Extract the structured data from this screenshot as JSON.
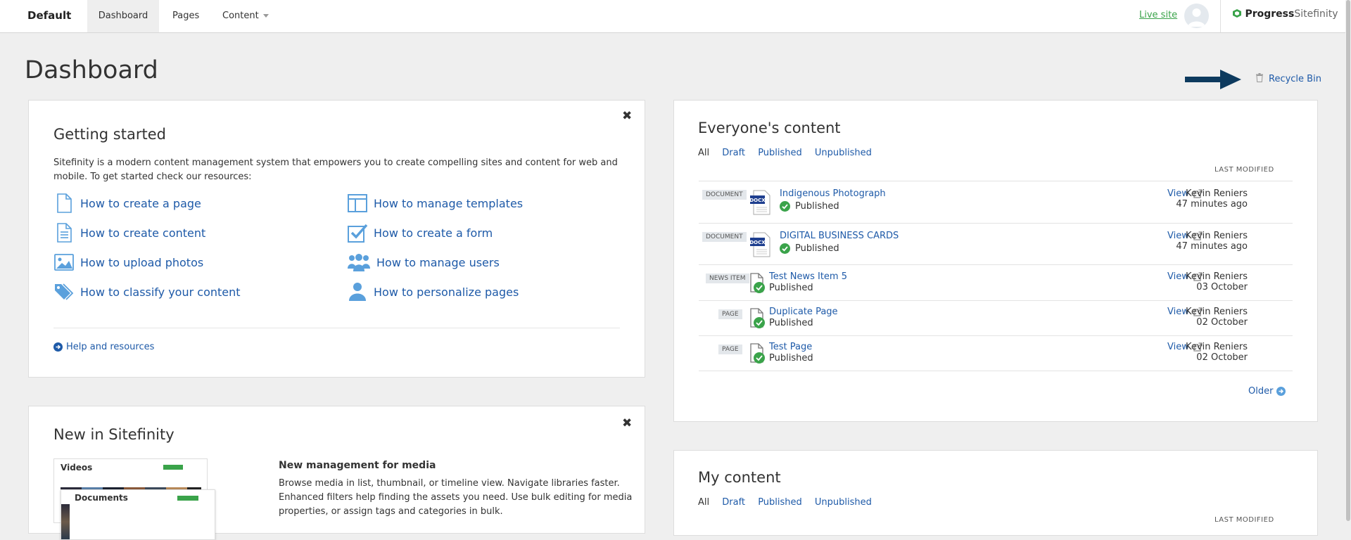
{
  "topbar": {
    "site_name": "Default",
    "tabs": [
      {
        "label": "Dashboard",
        "active": true
      },
      {
        "label": "Pages"
      },
      {
        "label": "Content"
      }
    ],
    "live_site": "Live site",
    "logo_progress": "Progress",
    "logo_sitefinity": "Sitefinity"
  },
  "page": {
    "title": "Dashboard",
    "recycle_bin": "Recycle Bin"
  },
  "getting_started": {
    "title": "Getting started",
    "intro": "Sitefinity is a modern content management system that empowers you to create compelling sites and content for web and mobile. To get started check our resources:",
    "links": [
      {
        "label": "How to create a page",
        "icon": "page-icon"
      },
      {
        "label": "How to create content",
        "icon": "content-icon"
      },
      {
        "label": "How to upload photos",
        "icon": "photo-icon"
      },
      {
        "label": "How to classify your content",
        "icon": "tags-icon"
      },
      {
        "label": "How to manage templates",
        "icon": "template-icon"
      },
      {
        "label": "How to create a form",
        "icon": "form-icon"
      },
      {
        "label": "How to manage users",
        "icon": "users-icon"
      },
      {
        "label": "How to personalize pages",
        "icon": "user-icon"
      }
    ],
    "help": "Help and resources"
  },
  "new_in": {
    "title": "New in Sitefinity",
    "subtitle": "New management for media",
    "description": "Browse media in list, thumbnail, or timeline view. Navigate libraries faster. Enhanced filters help finding the assets you need. Use bulk editing for media properties, or assign tags and categories in bulk.",
    "thumb_videos": "Videos",
    "thumb_documents": "Documents"
  },
  "everyones": {
    "title": "Everyone's content",
    "filters": [
      "All",
      "Draft",
      "Published",
      "Unpublished"
    ],
    "last_modified": "LAST MODIFIED",
    "rows": [
      {
        "type": "DOCUMENT",
        "title": "Indigenous Photograph",
        "status": "Published",
        "view": "View",
        "author": "Kevin Reniers",
        "time": "47 minutes ago",
        "icon": "docx"
      },
      {
        "type": "DOCUMENT",
        "title": "DIGITAL BUSINESS CARDS",
        "status": "Published",
        "view": "View",
        "author": "Kevin Reniers",
        "time": "47 minutes ago",
        "icon": "docx"
      },
      {
        "type": "NEWS ITEM",
        "title": "Test News Item 5",
        "status": "Published",
        "view": "View",
        "author": "Kevin Reniers",
        "time": "03 October",
        "icon": "page"
      },
      {
        "type": "PAGE",
        "title": "Duplicate Page",
        "status": "Published",
        "view": "View",
        "author": "Kevin Reniers",
        "time": "02 October",
        "icon": "page"
      },
      {
        "type": "PAGE",
        "title": "Test Page",
        "status": "Published",
        "view": "View",
        "author": "Kevin Reniers",
        "time": "02 October",
        "icon": "page"
      }
    ],
    "older": "Older"
  },
  "my_content": {
    "title": "My content",
    "filters": [
      "All",
      "Draft",
      "Published",
      "Unpublished"
    ],
    "last_modified": "LAST MODIFIED"
  },
  "colors": {
    "link": "#1e5aa8",
    "green": "#3aa34a",
    "arrow": "#0d3a5e",
    "docx_blue": "#1f3f8f"
  }
}
